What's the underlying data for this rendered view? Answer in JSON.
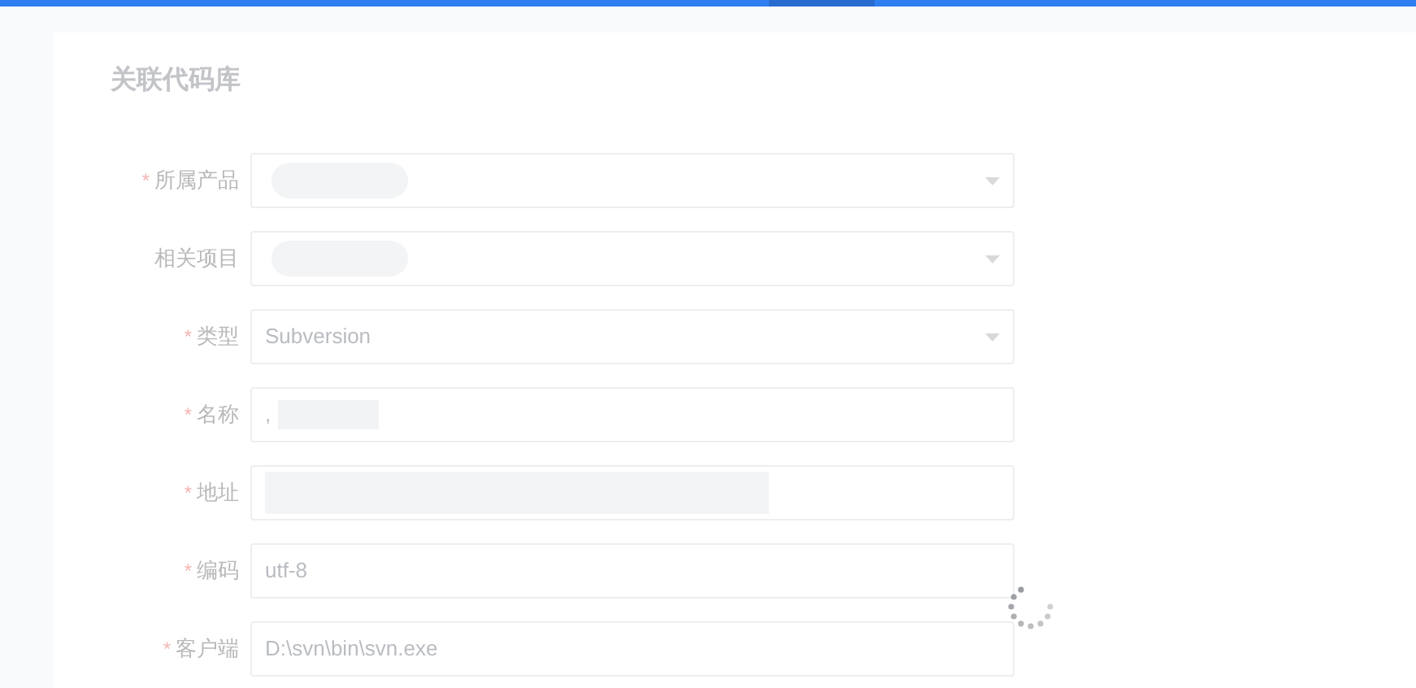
{
  "title": "关联代码库",
  "fields": [
    {
      "label": "所属产品",
      "required_mark": "*",
      "kind": "select",
      "blurred": true
    },
    {
      "label": "相关项目",
      "kind": "select",
      "blurred": true
    },
    {
      "label": "类型",
      "required_mark": "*",
      "kind": "select",
      "value": "Subversion"
    },
    {
      "label": "名称",
      "required_mark": "*",
      "kind": "input",
      "value": ",",
      "blurred": true
    },
    {
      "label": "地址",
      "required_mark": "*",
      "kind": "input",
      "blurred": true
    },
    {
      "label": "编码",
      "required_mark": "*",
      "kind": "input",
      "value": "utf-8"
    },
    {
      "label": "客户端",
      "required_mark": "*",
      "kind": "input",
      "value": "D:\\svn\\bin\\svn.exe"
    }
  ],
  "loading": true
}
